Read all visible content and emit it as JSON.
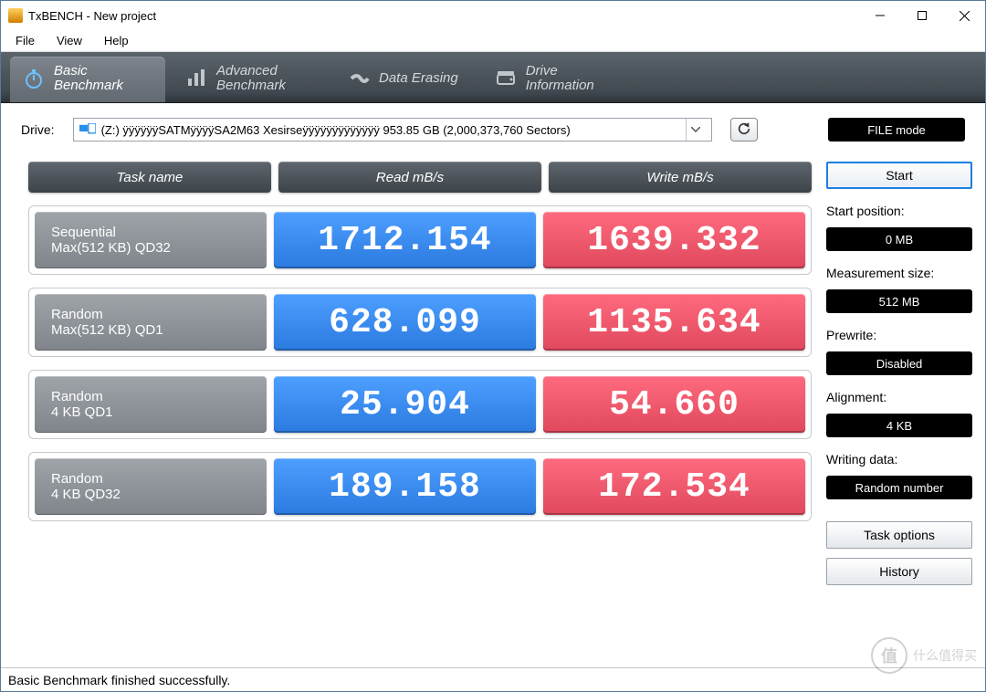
{
  "title": "TxBENCH - New project",
  "menu": {
    "file": "File",
    "view": "View",
    "help": "Help"
  },
  "tabs": {
    "basic": "Basic\nBenchmark",
    "advanced": "Advanced\nBenchmark",
    "erase": "Data Erasing",
    "info": "Drive\nInformation"
  },
  "drive": {
    "label": "Drive:",
    "selected": "(Z:) ÿÿÿÿÿÿSATMÿÿÿÿSA2M63 Xesirseÿÿÿÿÿÿÿÿÿÿÿÿÿ  953.85 GB (2,000,373,760 Sectors)",
    "filemode": "FILE mode"
  },
  "headers": {
    "task": "Task name",
    "read": "Read mB/s",
    "write": "Write mB/s"
  },
  "rows": [
    {
      "name1": "Sequential",
      "name2": "Max(512 KB) QD32",
      "read": "1712.154",
      "write": "1639.332"
    },
    {
      "name1": "Random",
      "name2": "Max(512 KB) QD1",
      "read": "628.099",
      "write": "1135.634"
    },
    {
      "name1": "Random",
      "name2": "4 KB QD1",
      "read": "25.904",
      "write": "54.660"
    },
    {
      "name1": "Random",
      "name2": "4 KB QD32",
      "read": "189.158",
      "write": "172.534"
    }
  ],
  "side": {
    "start": "Start",
    "startpos_lbl": "Start position:",
    "startpos_val": "0 MB",
    "msize_lbl": "Measurement size:",
    "msize_val": "512 MB",
    "prewrite_lbl": "Prewrite:",
    "prewrite_val": "Disabled",
    "align_lbl": "Alignment:",
    "align_val": "4 KB",
    "wdata_lbl": "Writing data:",
    "wdata_val": "Random number",
    "taskopt": "Task options",
    "history": "History"
  },
  "status": "Basic Benchmark finished successfully.",
  "watermark": {
    "badge": "值",
    "text": "什么值得买"
  }
}
